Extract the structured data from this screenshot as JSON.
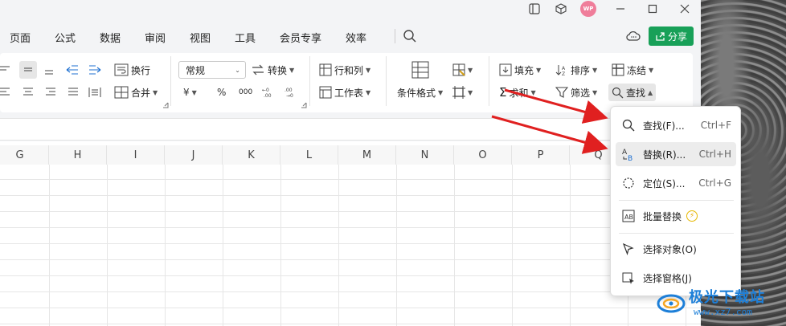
{
  "menu": {
    "tabs": [
      "页面",
      "公式",
      "数据",
      "审阅",
      "视图",
      "工具",
      "会员专享",
      "效率"
    ],
    "share_label": "分享",
    "avatar_text": "WP"
  },
  "ribbon": {
    "wrap_label": "换行",
    "merge_label": "合并",
    "number_format": "常规",
    "convert_label": "转换",
    "currency_symbol": "¥",
    "percent_symbol": "%",
    "thousands_symbol": "000",
    "rows_cols_label": "行和列",
    "worksheet_label": "工作表",
    "conditional_format_label": "条件格式",
    "fill_label": "填充",
    "sort_label": "排序",
    "freeze_label": "冻结",
    "sum_label": "求和",
    "filter_label": "筛选",
    "find_label": "查找"
  },
  "grid": {
    "columns": [
      "G",
      "H",
      "I",
      "J",
      "K",
      "L",
      "M",
      "N",
      "O",
      "P",
      "Q"
    ]
  },
  "find_menu": {
    "items": [
      {
        "label": "查找(F)...",
        "shortcut": "Ctrl+F",
        "icon": "search-icon"
      },
      {
        "label": "替换(R)...",
        "shortcut": "Ctrl+H",
        "icon": "replace-icon"
      },
      {
        "label": "定位(S)...",
        "shortcut": "Ctrl+G",
        "icon": "locate-icon"
      },
      {
        "label": "批量替换",
        "shortcut": "",
        "icon": "batch-replace-icon"
      },
      {
        "label": "选择对象(O)",
        "shortcut": "",
        "icon": "select-object-icon"
      },
      {
        "label": "选择窗格(J)",
        "shortcut": "",
        "icon": "selection-pane-icon"
      }
    ]
  },
  "watermark": {
    "name": "极光下载站",
    "url": "www.xz7.com"
  },
  "colors": {
    "share_button": "#18a058",
    "annotation_arrow": "#e02020",
    "watermark": "#1d7fd8"
  }
}
